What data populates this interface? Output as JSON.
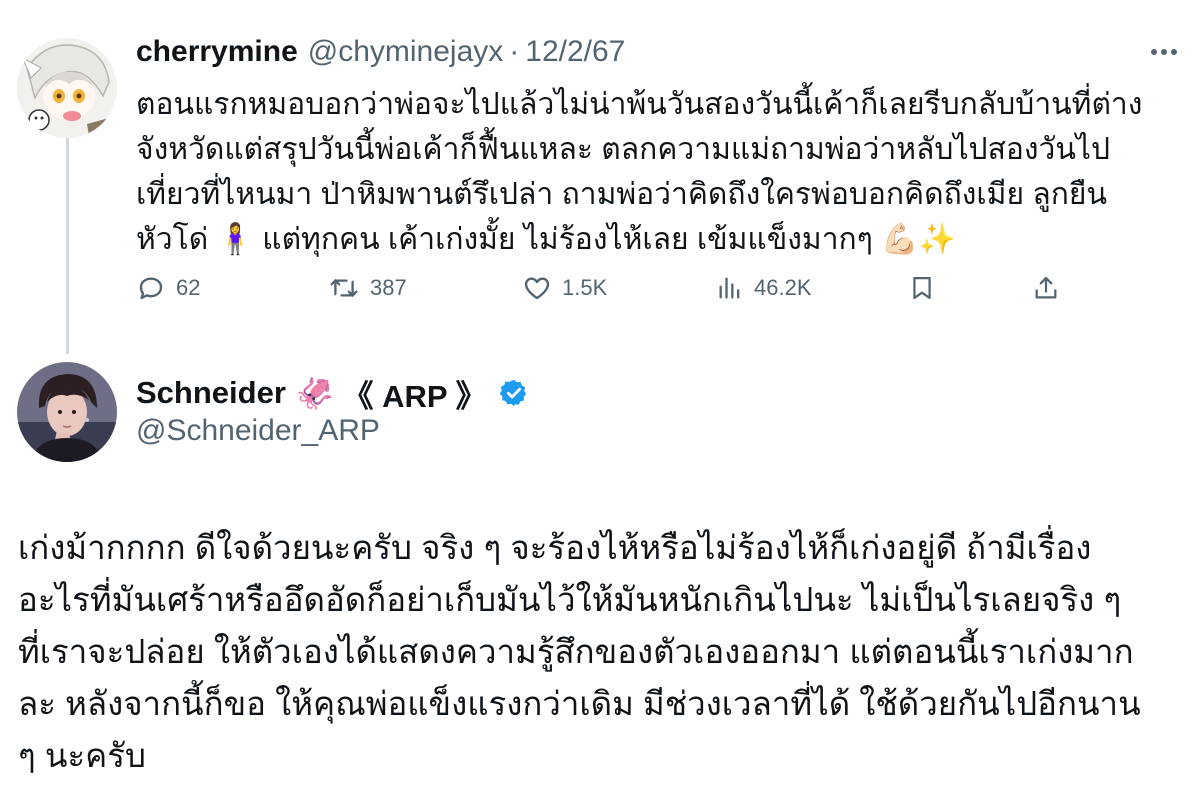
{
  "reply_to": {
    "author_name": "cherrymine",
    "author_handle": "@chyminejayx",
    "separator": "·",
    "date": "12/2/67",
    "text_lines": [
      "ตอนแรกหมอบอกว่าพ่อจะไปแล้วไม่น่าพ้นวันสองวันนี้เค้าก็เลยรีบกลับบ้านที่ต่าง",
      "จังหวัดแต่สรุปวันนี้พ่อเค้าก็ฟื้นแหละ ตลกความแม่ถามพ่อว่าหลับไปสองวันไป",
      "เที่ยวที่ไหนมา ป่าหิมพานต์รึเปล่า ถามพ่อว่าคิดถึงใครพ่อบอกคิดถึงเมีย ลูกยืน",
      "หัวโด่ 🧍‍♀️ แต่ทุกคน เค้าเก่งมั้ย ไม่ร้องไห้เลย เข้มแข็งมากๆ 💪🏻✨"
    ],
    "stats": {
      "replies": "62",
      "reposts": "387",
      "likes": "1.5K",
      "views": "46.2K"
    },
    "icons": [
      "reply-icon",
      "repost-icon",
      "like-icon",
      "views-icon",
      "bookmark-icon",
      "share-icon",
      "more-icon"
    ]
  },
  "main_post": {
    "author_name": "Schneider",
    "name_emoji": "🦑",
    "name_suffix": "《 ARP 》",
    "author_handle": "@Schneider_ARP",
    "verified": true,
    "verified_color": "#1d9bf0",
    "text_lines": [
      "เก่งม้ากกกก ดีใจด้วยนะครับ จริง ๆ จะร้องไห้หรือไม่ร้องไห้ก็เก่งอยู่ดี ถ้ามีเรื่อง",
      "อะไรที่มันเศร้าหรืออึดอัดก็อย่าเก็บมันไว้ให้มันหนักเกินไปนะ ไม่เป็นไรเลยจริง ๆ",
      "ที่เราจะปล่อย ให้ตัวเองได้แสดงความรู้สึกของตัวเองออกมา แต่ตอนนี้เราเก่งมาก",
      "ละ หลังจากนี้ก็ขอ ให้คุณพ่อแข็งแรงกว่าเดิม มีช่วงเวลาที่ได้ ใช้ด้วยกันไปอีกนาน",
      "ๆ นะครับ"
    ]
  },
  "colors": {
    "text": "#0f1419",
    "secondary": "#536471",
    "thread_line": "#cfd9de"
  }
}
